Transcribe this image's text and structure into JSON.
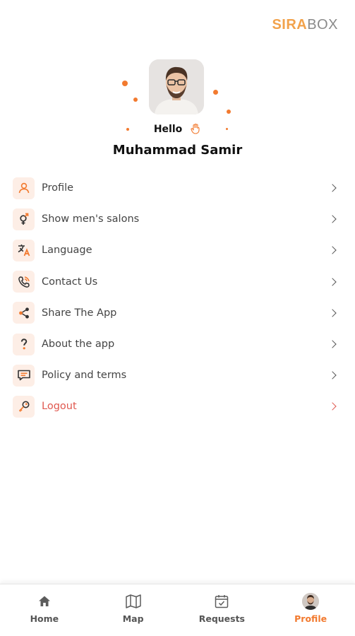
{
  "brand": {
    "part1": "SIRA",
    "part2": "BOX"
  },
  "colors": {
    "accent": "#f27a2f",
    "logout": "#e0584f",
    "icon_bg": "#fdeee6"
  },
  "profile": {
    "greeting": "Hello",
    "name": "Muhammad Samir"
  },
  "menu": {
    "items": [
      {
        "label": "Profile",
        "icon": "user-icon"
      },
      {
        "label": "Show men's salons",
        "icon": "gender-icon"
      },
      {
        "label": "Language",
        "icon": "translate-icon"
      },
      {
        "label": "Contact Us",
        "icon": "phone-icon"
      },
      {
        "label": "Share The App",
        "icon": "share-icon"
      },
      {
        "label": "About the app",
        "icon": "question-icon"
      },
      {
        "label": "Policy and terms",
        "icon": "message-icon"
      },
      {
        "label": "Logout",
        "icon": "key-icon"
      }
    ]
  },
  "nav": {
    "home": "Home",
    "map": "Map",
    "requests": "Requests",
    "profile": "Profile",
    "active": "profile"
  }
}
